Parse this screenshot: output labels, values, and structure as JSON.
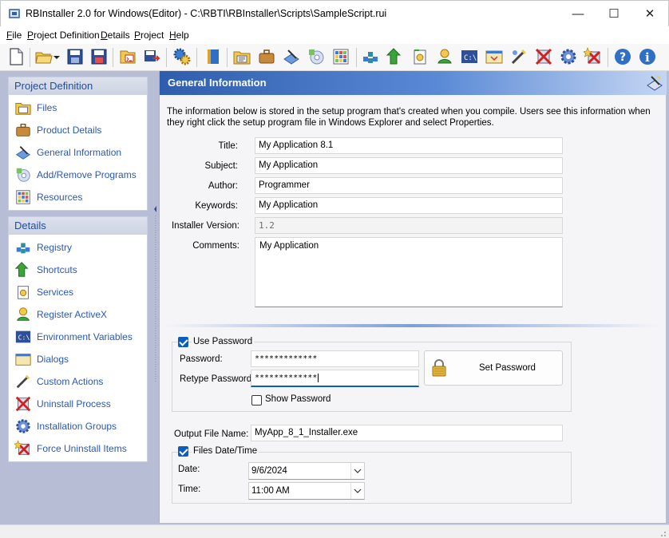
{
  "window": {
    "title": "RBInstaller 2.0 for Windows(Editor) - C:\\RBTI\\RBInstaller\\Scripts\\SampleScript.rui",
    "min_glyph": "—",
    "max_glyph": "☐",
    "close_glyph": "✕"
  },
  "menu": [
    {
      "label": "File"
    },
    {
      "label": "Project Definition"
    },
    {
      "label": "Details"
    },
    {
      "label": "Project"
    },
    {
      "label": "Help"
    }
  ],
  "toolbar_icons": [
    "new-document-icon",
    "open-folder-icon",
    "save-icon",
    "save-as-icon",
    "script-icon",
    "export-icon",
    "build-gears-icon",
    "book-icon",
    "files-icon",
    "briefcase-icon",
    "general-info-icon",
    "add-remove-icon",
    "resources-icon",
    "registry-icon",
    "shortcut-arrow-icon",
    "services-icon",
    "register-activex-icon",
    "env-variables-icon",
    "dialogs-icon",
    "custom-actions-icon",
    "uninstall-icon",
    "gear-icon",
    "force-uninstall-icon",
    "help-icon",
    "info-icon"
  ],
  "sidebar": {
    "project_definition": {
      "header": "Project Definition",
      "items": [
        {
          "label": "Files",
          "icon": "files-icon"
        },
        {
          "label": "Product Details",
          "icon": "briefcase-icon"
        },
        {
          "label": "General Information",
          "icon": "general-info-icon"
        },
        {
          "label": "Add/Remove Programs",
          "icon": "add-remove-icon"
        },
        {
          "label": "Resources",
          "icon": "resources-icon"
        }
      ]
    },
    "details": {
      "header": "Details",
      "items": [
        {
          "label": "Registry",
          "icon": "registry-icon"
        },
        {
          "label": "Shortcuts",
          "icon": "shortcut-arrow-icon"
        },
        {
          "label": "Services",
          "icon": "services-icon"
        },
        {
          "label": "Register ActiveX",
          "icon": "register-activex-icon"
        },
        {
          "label": "Environment Variables",
          "icon": "env-variables-icon"
        },
        {
          "label": "Dialogs",
          "icon": "dialogs-icon"
        },
        {
          "label": "Custom Actions",
          "icon": "custom-actions-icon"
        },
        {
          "label": "Uninstall Process",
          "icon": "uninstall-icon"
        },
        {
          "label": "Installation Groups",
          "icon": "gear-icon"
        },
        {
          "label": "Force Uninstall Items",
          "icon": "force-uninstall-icon"
        }
      ]
    }
  },
  "main": {
    "header": "General Information",
    "description": "The information below is stored in the setup program that's created when you compile. Users see this information when they right click the setup program file in Windows Explorer and select Properties.",
    "fields": {
      "title": {
        "label": "Title:",
        "value": "My Application 8.1"
      },
      "subject": {
        "label": "Subject:",
        "value": "My Application"
      },
      "author": {
        "label": "Author:",
        "value": "Programmer"
      },
      "keywords": {
        "label": "Keywords:",
        "value": "My Application"
      },
      "installer_version": {
        "label": "Installer Version:",
        "value": "1.2"
      },
      "comments": {
        "label": "Comments:",
        "value": "My Application"
      }
    },
    "password": {
      "use_password_label": "Use Password",
      "use_password_checked": true,
      "password_label": "Password:",
      "password_value": "*************",
      "retype_label": "Retype Password:",
      "retype_value": "*************",
      "set_password_button": "Set Password",
      "show_password_label": "Show Password",
      "show_password_checked": false
    },
    "output_file": {
      "label": "Output File Name:",
      "value": "MyApp_8_1_Installer.exe"
    },
    "files_datetime": {
      "label": "Files Date/Time",
      "checked": true,
      "date_label": "Date:",
      "date_value": "9/6/2024",
      "time_label": "Time:",
      "time_value": "11:00 AM"
    }
  },
  "colors": {
    "header_gradient_start": "#2e5dad",
    "nav_link": "#2a58b8",
    "workspace_bg": "#b6bdd4",
    "accent": "#0a5ebd"
  }
}
